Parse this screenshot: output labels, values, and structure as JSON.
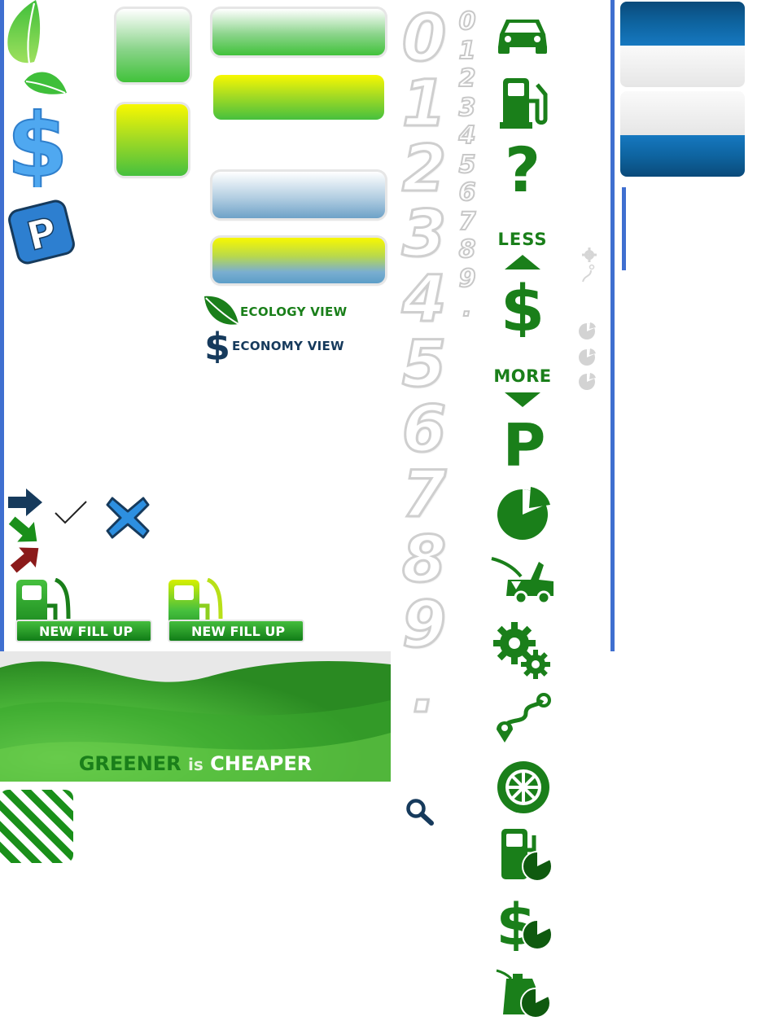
{
  "colors": {
    "green": "#1a7f1a",
    "dark_green": "#0f5a0f",
    "bright_green": "#3fbf3a",
    "blue": "#3a8fd8",
    "navy": "#163a5c",
    "rail_blue": "#3f6fd0",
    "tab_blue": "#0e64a0",
    "red": "#8b1a1a"
  },
  "icons": {
    "left_column": [
      "leaf-icon",
      "leaf-small-icon",
      "dollar-icon",
      "parking-icon"
    ],
    "right_column": [
      "car-icon",
      "fuel-pump-icon",
      "question-icon",
      "less-money-icon",
      "more-parking-icon",
      "pie-chart-icon",
      "car-hood-open-icon",
      "gears-icon",
      "route-icon",
      "wheel-icon",
      "fuel-pie-icon",
      "dollar-pie-icon",
      "oil-can-pie-icon"
    ],
    "small_column": [
      "gear-route-icon",
      "pie-small-icon-1",
      "pie-small-icon-2",
      "pie-small-icon-3"
    ],
    "misc": [
      "arrow-right-icon",
      "arrow-down-right-icon",
      "arrow-up-right-icon",
      "checkmark-icon",
      "close-x-icon",
      "search-icon",
      "stripes-icon"
    ]
  },
  "labels": {
    "ecology_view": "ECOLOGY VIEW",
    "economy_view": "ECONOMY VIEW",
    "new_fill_up_1": "NEW FILL UP",
    "new_fill_up_2": "NEW FILL UP",
    "less": "LESS",
    "more": "MORE",
    "question": "?"
  },
  "banner": {
    "word1": "GREENER",
    "word2": "is",
    "word3": "CHEAPER"
  },
  "digits_large": [
    "0",
    "1",
    "2",
    "3",
    "4",
    "5",
    "6",
    "7",
    "8",
    "9",
    "."
  ],
  "digits_small": [
    "0",
    "1",
    "2",
    "3",
    "4",
    "5",
    "6",
    "7",
    "8",
    "9",
    "."
  ]
}
